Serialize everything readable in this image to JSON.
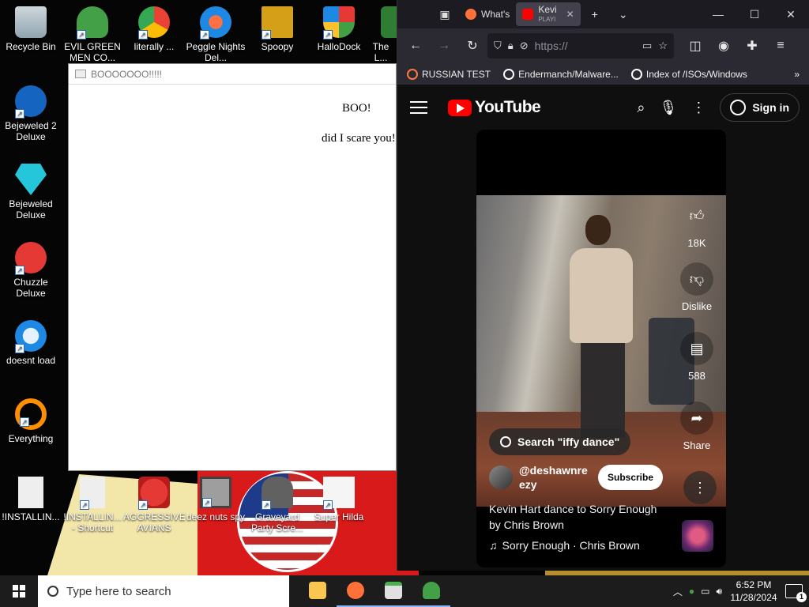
{
  "desktop": {
    "icons": [
      {
        "label": "Recycle Bin",
        "icon": "recycle-bin-icon",
        "color": "#cfd8dc"
      },
      {
        "label": "EVIL GREEN MEN CO...",
        "icon": "green-people-icon",
        "color": "#43a047"
      },
      {
        "label": "literally ...",
        "icon": "chrome-icon",
        "color": "#fbbc04"
      },
      {
        "label": "Peggle Nights Del...",
        "icon": "peggle-icon",
        "color": "#1e88e5"
      },
      {
        "label": "Spoopy",
        "icon": "spoopy-icon",
        "color": "#d4a017"
      },
      {
        "label": "HalloDock",
        "icon": "windows-shield-icon",
        "color": "#e53935"
      },
      {
        "label": "The L...",
        "icon": "game-icon",
        "color": "#2e7d32"
      },
      {
        "label": "Bejeweled 2 Deluxe",
        "icon": "bejeweled-2-icon",
        "color": "#1565c0"
      },
      {
        "label": "Bejeweled Deluxe",
        "icon": "diamond-icon",
        "color": "#26c6da"
      },
      {
        "label": "Chuzzle Deluxe",
        "icon": "chuzzle-icon",
        "color": "#e53935"
      },
      {
        "label": "doesnt load",
        "icon": "thunderbird-icon",
        "color": "#1e88e5"
      },
      {
        "label": "Everything",
        "icon": "everything-search-icon",
        "color": "#ff8f00"
      },
      {
        "label": "!INSTALLIN...",
        "icon": "text-file-icon",
        "color": "#eeeeee"
      },
      {
        "label": "!INSTALLIN... - Shortcut",
        "icon": "text-file-shortcut-icon",
        "color": "#eeeeee"
      },
      {
        "label": "AGGRESSIVE AVIANS",
        "icon": "angry-bird-icon",
        "color": "#e53935"
      },
      {
        "label": "deez nuts spy",
        "icon": "windows-stack-icon",
        "color": "#9e9e9e"
      },
      {
        "label": "Graveyard Party Scre...",
        "icon": "graveyard-icon",
        "color": "#616161"
      },
      {
        "label": "Super Hilda",
        "icon": "pixel-dog-icon",
        "color": "#f5f5f5"
      }
    ]
  },
  "popup": {
    "title": "BOOOOOOO!!!!!",
    "line1": "BOO!",
    "line2": "did I scare you!"
  },
  "browser": {
    "tabs": [
      {
        "label": "What's",
        "favicon": "firefox-icon",
        "color": "#ff7139"
      },
      {
        "label": "Kevi",
        "sublabel": "PLAYI",
        "favicon": "youtube-icon",
        "color": "#ff0000",
        "active": true
      }
    ],
    "url": "https://",
    "bookmarks": [
      {
        "label": "RUSSIAN TEST",
        "icon": "search-bookmark-icon",
        "color": "#ff7a3d"
      },
      {
        "label": "Endermanch/Malware...",
        "icon": "github-icon",
        "color": "#ffffff"
      },
      {
        "label": "Index of /ISOs/Windows",
        "icon": "globe-icon",
        "color": "#ffffff"
      }
    ]
  },
  "youtube": {
    "logo_text": "YouTube",
    "sign_in": "Sign in",
    "likes": "18K",
    "dislike_label": "Dislike",
    "comments": "588",
    "share_label": "Share",
    "search_chip": "Search \"iffy dance\"",
    "channel": "@deshawnreezy",
    "channel_line1": "@deshawnre",
    "channel_line2": "ezy",
    "subscribe": "Subscribe",
    "video_title": "Kevin Hart dance to Sorry Enough by Chris Brown",
    "music": "Sorry Enough · Chris Brown"
  },
  "taskbar": {
    "search_placeholder": "Type here to search",
    "apps": [
      {
        "name": "file-explorer-icon",
        "color": "#f9c74f"
      },
      {
        "name": "firefox-icon",
        "color": "#ff7139"
      },
      {
        "name": "popup-window-icon",
        "color": "#4caf50"
      },
      {
        "name": "green-people-icon",
        "color": "#43a047"
      }
    ],
    "time": "6:52 PM",
    "date": "11/28/2024",
    "notification_count": "1"
  },
  "colors": {
    "youtube_red": "#ff0000",
    "browser_chrome": "#2b2a33",
    "taskbar": "#1c1c1c"
  }
}
